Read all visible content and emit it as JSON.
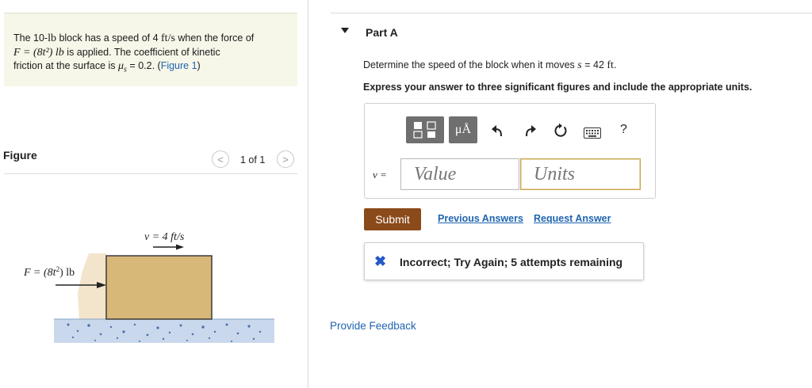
{
  "problem": {
    "line1_a": "The 10-",
    "unit_lb": "lb",
    "line1_b": " block has a speed of 4 ",
    "unit_fts": "ft/s",
    "line1_c": " when the force of",
    "force_expr": "F = (8t²) lb",
    "line2_b": " is applied. The coefficient of kinetic",
    "line3_a": "friction at the surface is ",
    "mu_symbol": "μ",
    "mu_sub": "s",
    "line3_b": " = 0.2. (",
    "figure_link": "Figure 1",
    "line3_c": ")"
  },
  "figure": {
    "label": "Figure",
    "pager_text": "1 of 1",
    "prev_glyph": "<",
    "next_glyph": ">",
    "velocity_label": "v = 4 ft/s",
    "force_label_a": "F = (8t",
    "force_label_sup": "2",
    "force_label_b": ") lb",
    "colors": {
      "block": "#d8b878",
      "ground": "#b9cde8",
      "shadow": "#f3e4cc"
    }
  },
  "part": {
    "title": "Part A",
    "question_a": "Determine the speed of the block when it moves ",
    "question_var": "s",
    "question_b": " = 42 ",
    "question_unit": "ft",
    "question_c": ".",
    "instruction": "Express your answer to three significant figures and include the appropriate units."
  },
  "toolbar": {
    "template_icon": "fraction-template-icon",
    "units_button": "μÅ",
    "undo_icon": "undo-icon",
    "redo_icon": "redo-icon",
    "reset_icon": "reset-icon",
    "keyboard_icon": "keyboard-icon",
    "help_label": "?"
  },
  "answer": {
    "var_label": "v =",
    "value_placeholder": "Value",
    "units_placeholder": "Units"
  },
  "actions": {
    "submit": "Submit",
    "previous_answers": "Previous Answers",
    "request_answer": "Request Answer"
  },
  "feedback": {
    "icon": "✖",
    "message": "Incorrect; Try Again; 5 attempts remaining",
    "color": "#2558c8"
  },
  "footer": {
    "provide_feedback": "Provide Feedback"
  },
  "colors": {
    "link": "#1f64b0",
    "submit_bg": "#8b4a1a",
    "problem_bg": "#f6f6e9",
    "tool_bg": "#6f6f6f"
  }
}
